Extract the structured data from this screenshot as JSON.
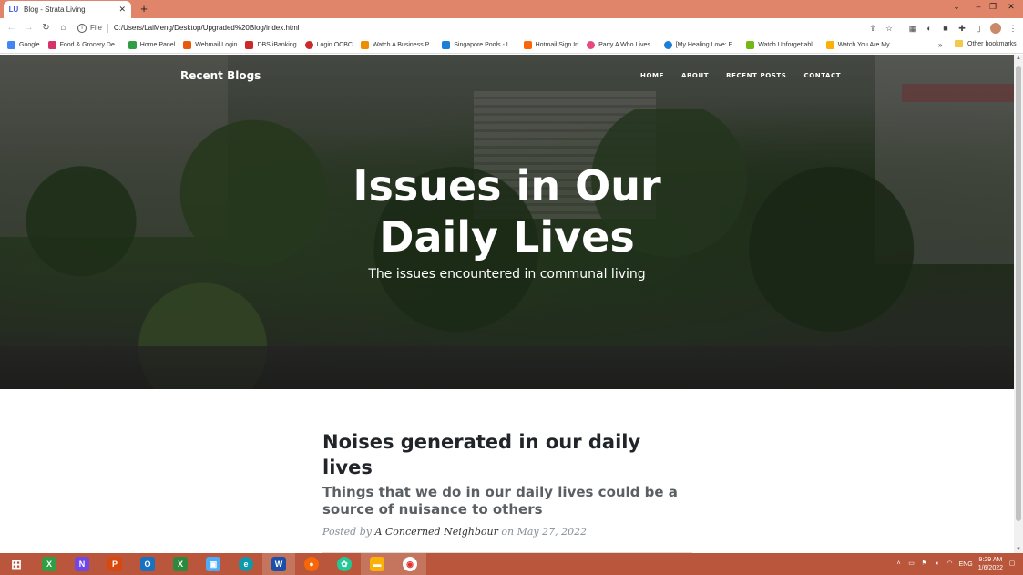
{
  "browser": {
    "tab": {
      "title": "Blog - Strata Living",
      "favicon": "LU"
    },
    "window_controls": [
      "chevron-down-icon",
      "minimize-icon",
      "maximize-icon",
      "close-icon"
    ],
    "address": {
      "scheme": "File",
      "url": "C:/Users/LaiMeng/Desktop/Upgraded%20Blog/index.html"
    },
    "bookmarks": [
      {
        "label": "Google",
        "color": "#4285f4"
      },
      {
        "label": "Food & Grocery De...",
        "color": "#d6336c"
      },
      {
        "label": "Home Panel",
        "color": "#2f9e44"
      },
      {
        "label": "Webmail Login",
        "color": "#e8590c"
      },
      {
        "label": "DBS iBanking",
        "color": "#c92a2a"
      },
      {
        "label": "Login OCBC",
        "color": "#c92a2a"
      },
      {
        "label": "Watch A Business P...",
        "color": "#f08c00"
      },
      {
        "label": "Singapore Pools - L...",
        "color": "#1c7ed6"
      },
      {
        "label": "Hotmail Sign In",
        "color": "#f76707"
      },
      {
        "label": "Party A Who Lives...",
        "color": "#e64980"
      },
      {
        "label": "[My Healing Love: E...",
        "color": "#1c7ed6"
      },
      {
        "label": "Watch Unforgettabl...",
        "color": "#74b816"
      },
      {
        "label": "Watch You Are My...",
        "color": "#fab005"
      }
    ],
    "more_bookmarks": "»",
    "other_bookmarks": "Other bookmarks"
  },
  "page": {
    "brand": "Recent Blogs",
    "nav": [
      "HOME",
      "ABOUT",
      "RECENT POSTS",
      "CONTACT"
    ],
    "hero": {
      "title_line1": "Issues in Our",
      "title_line2": "Daily Lives",
      "subtitle": "The issues encountered in communal living"
    },
    "post": {
      "title": "Noises generated in our daily lives",
      "subtitle": "Things that we do in our daily lives could be a source of nuisance to others",
      "meta_prefix": "Posted by",
      "author": "A Concerned Neighbour",
      "meta_on": "on",
      "date": "May 27, 2022"
    }
  },
  "taskbar": {
    "apps": [
      {
        "name": "windows-start",
        "glyph": "⊞",
        "color": "#b9563b"
      },
      {
        "name": "xbox-app",
        "glyph": "X",
        "color": "#2f9e44"
      },
      {
        "name": "onenote-app",
        "glyph": "N",
        "color": "#7048e8"
      },
      {
        "name": "powerpoint-app",
        "glyph": "P",
        "color": "#d9480f"
      },
      {
        "name": "outlook-app",
        "glyph": "O",
        "color": "#1971c2"
      },
      {
        "name": "excel-app",
        "glyph": "X",
        "color": "#2b8a3e"
      },
      {
        "name": "remote-app",
        "glyph": "▣",
        "color": "#4dabf7"
      },
      {
        "name": "edge-app",
        "glyph": "e",
        "color": "#1098ad"
      },
      {
        "name": "word-app",
        "glyph": "W",
        "color": "#1c4fa8"
      },
      {
        "name": "firefox-app",
        "glyph": "●",
        "color": "#f76707"
      },
      {
        "name": "chatgpt-app",
        "glyph": "✿",
        "color": "#20c997"
      },
      {
        "name": "file-explorer-app",
        "glyph": "▬",
        "color": "#fab005"
      },
      {
        "name": "chrome-app",
        "glyph": "◉",
        "color": "#e03131"
      }
    ],
    "tray": {
      "language": "ENG",
      "time": "9:29 AM",
      "date": "1/6/2022"
    }
  }
}
